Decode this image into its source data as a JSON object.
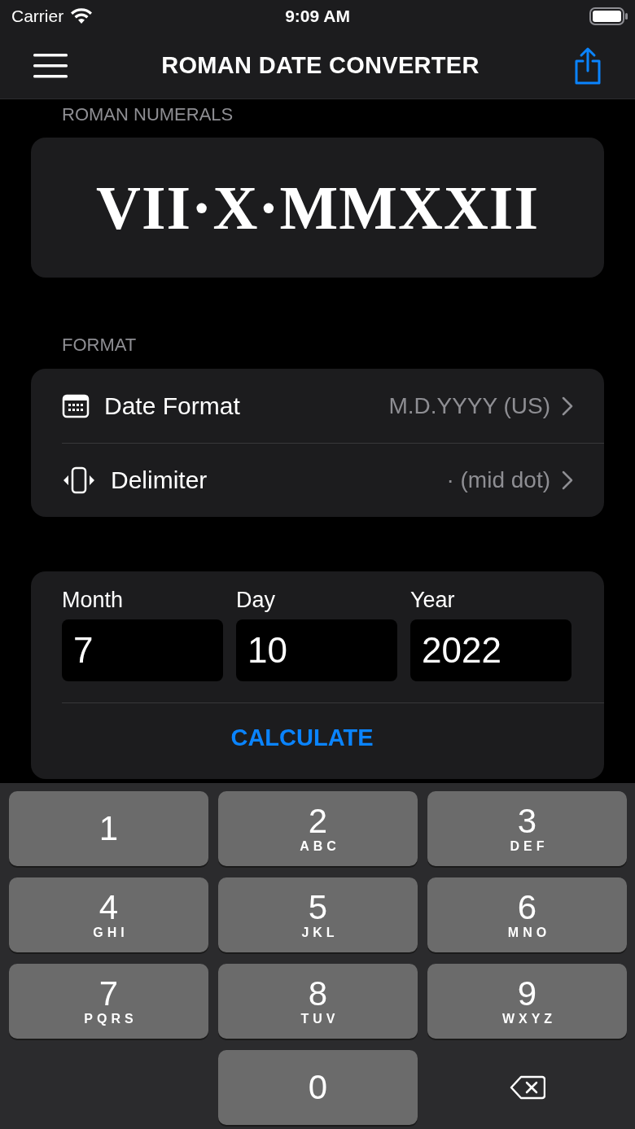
{
  "status_bar": {
    "carrier": "Carrier",
    "time": "9:09 AM"
  },
  "nav": {
    "title": "ROMAN DATE CONVERTER"
  },
  "roman": {
    "label": "ROMAN NUMERALS",
    "value": "VII·X·MMXXII"
  },
  "format": {
    "label": "FORMAT",
    "rows": [
      {
        "kind": "calendar",
        "title": "Date Format",
        "value": "M.D.YYYY (US)"
      },
      {
        "kind": "delimiter",
        "title": "Delimiter",
        "value": "· (mid dot)"
      }
    ]
  },
  "inputs": [
    {
      "label": "Month",
      "value": "7"
    },
    {
      "label": "Day",
      "value": "10"
    },
    {
      "label": "Year",
      "value": "2022"
    }
  ],
  "calculate": "CALCULATE",
  "keyboard": [
    {
      "kind": "digit",
      "digit": "1"
    },
    {
      "kind": "digit",
      "digit": "2",
      "letters": "ABC"
    },
    {
      "kind": "digit",
      "digit": "3",
      "letters": "DEF"
    },
    {
      "kind": "digit",
      "digit": "4",
      "letters": "GHI"
    },
    {
      "kind": "digit",
      "digit": "5",
      "letters": "JKL"
    },
    {
      "kind": "digit",
      "digit": "6",
      "letters": "MNO"
    },
    {
      "kind": "digit",
      "digit": "7",
      "letters": "PQRS"
    },
    {
      "kind": "digit",
      "digit": "8",
      "letters": "TUV"
    },
    {
      "kind": "digit",
      "digit": "9",
      "letters": "WXYZ"
    },
    {
      "kind": "digit",
      "digit": "0"
    },
    {
      "kind": "delete"
    }
  ]
}
